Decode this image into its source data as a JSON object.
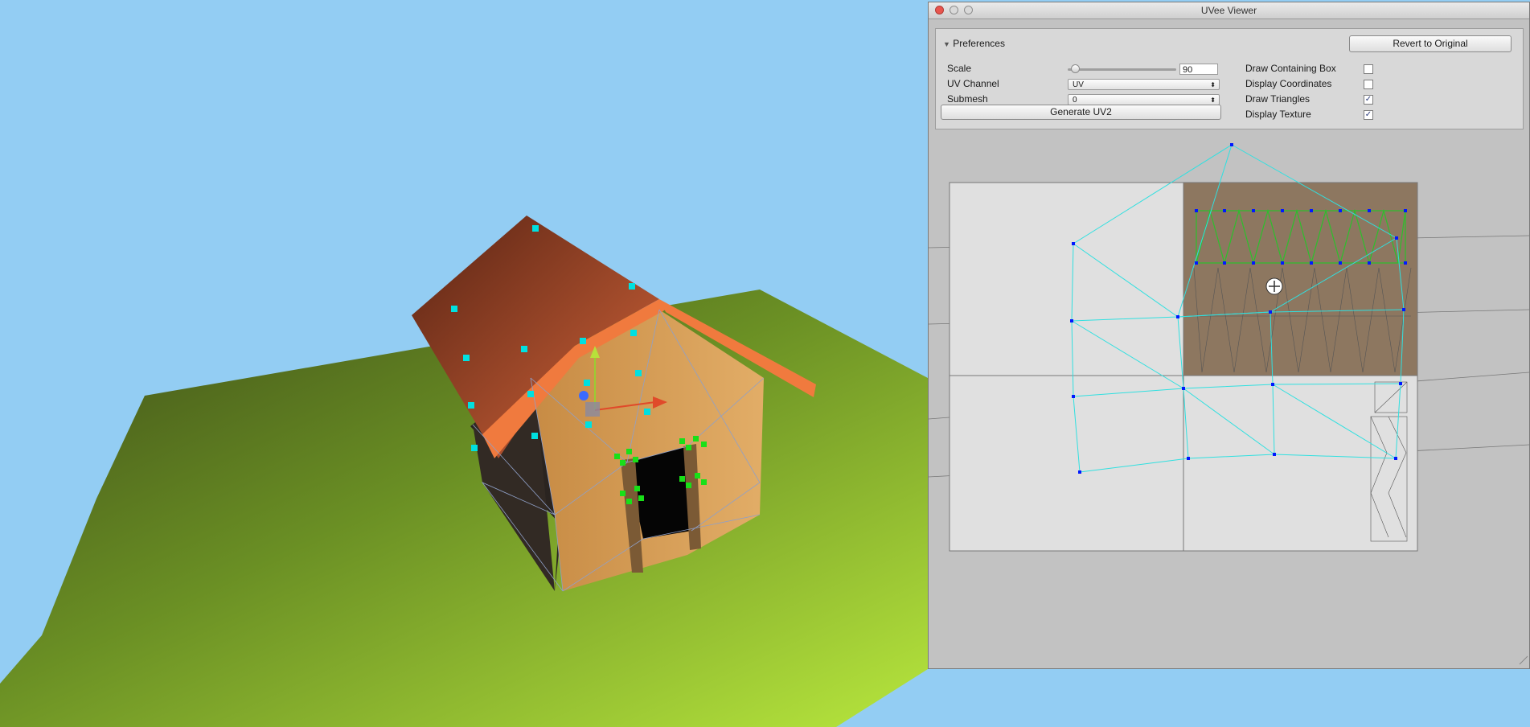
{
  "window": {
    "title": "UVee Viewer"
  },
  "preferences": {
    "header": "Preferences",
    "revert_label": "Revert to Original",
    "scale_label": "Scale",
    "scale_value": "90",
    "uv_channel_label": "UV Channel",
    "uv_channel_value": "UV",
    "submesh_label": "Submesh",
    "submesh_value": "0",
    "generate_label": "Generate UV2",
    "draw_containing_box_label": "Draw Containing Box",
    "draw_containing_box_checked": false,
    "display_coordinates_label": "Display Coordinates",
    "display_coordinates_checked": false,
    "draw_triangles_label": "Draw Triangles",
    "draw_triangles_checked": true,
    "display_texture_label": "Display Texture",
    "display_texture_checked": true,
    "checkmark": "✓",
    "dropdown_arrow": "⬍",
    "fold_arrow": "▼"
  },
  "colors": {
    "sky": "#93cdf3",
    "roof": "#c4552f",
    "wall": "#d19a55",
    "vertex_selected": "#00e0e0",
    "vertex_green": "#18e018",
    "uv_edge": "#30e0e0",
    "uv_green": "#30c030",
    "uv_vertex": "#0018ff"
  }
}
